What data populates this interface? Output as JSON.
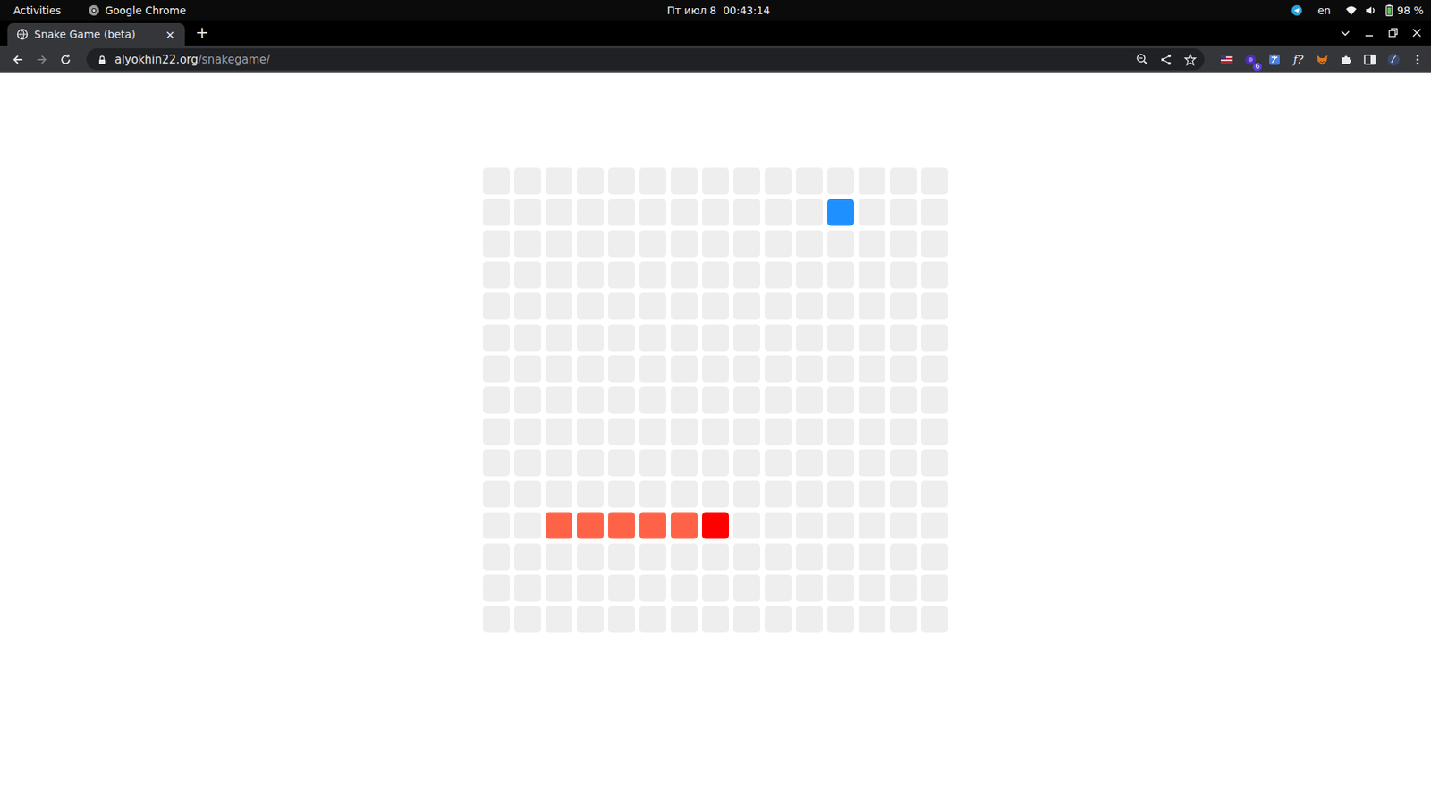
{
  "top_bar": {
    "activities": "Activities",
    "app": "Google Chrome",
    "clock": "Пт июл 8  00:43:14",
    "keyboard_layout": "en",
    "battery": "98 %"
  },
  "browser": {
    "tabs": [
      {
        "label": "Snake Game (beta)",
        "selected": true,
        "close": "×"
      }
    ],
    "new_tab": "+",
    "url_host": "alyokhin22.org",
    "url_path": "/snakegame/",
    "extension_badge": "6",
    "extension_label": "f?"
  },
  "game": {
    "rows": 15,
    "cols": 15,
    "snake": [
      {
        "row": 11,
        "col": 2,
        "kind": "body",
        "color": "#ff6347"
      },
      {
        "row": 11,
        "col": 3,
        "kind": "body",
        "color": "#ff6347"
      },
      {
        "row": 11,
        "col": 4,
        "kind": "body",
        "color": "#ff6347"
      },
      {
        "row": 11,
        "col": 5,
        "kind": "body",
        "color": "#ff6347"
      },
      {
        "row": 11,
        "col": 6,
        "kind": "body",
        "color": "#ff6347"
      },
      {
        "row": 11,
        "col": 7,
        "kind": "head",
        "color": "#ff0000"
      }
    ],
    "food": {
      "row": 1,
      "col": 11,
      "color": "#1e90ff"
    }
  }
}
